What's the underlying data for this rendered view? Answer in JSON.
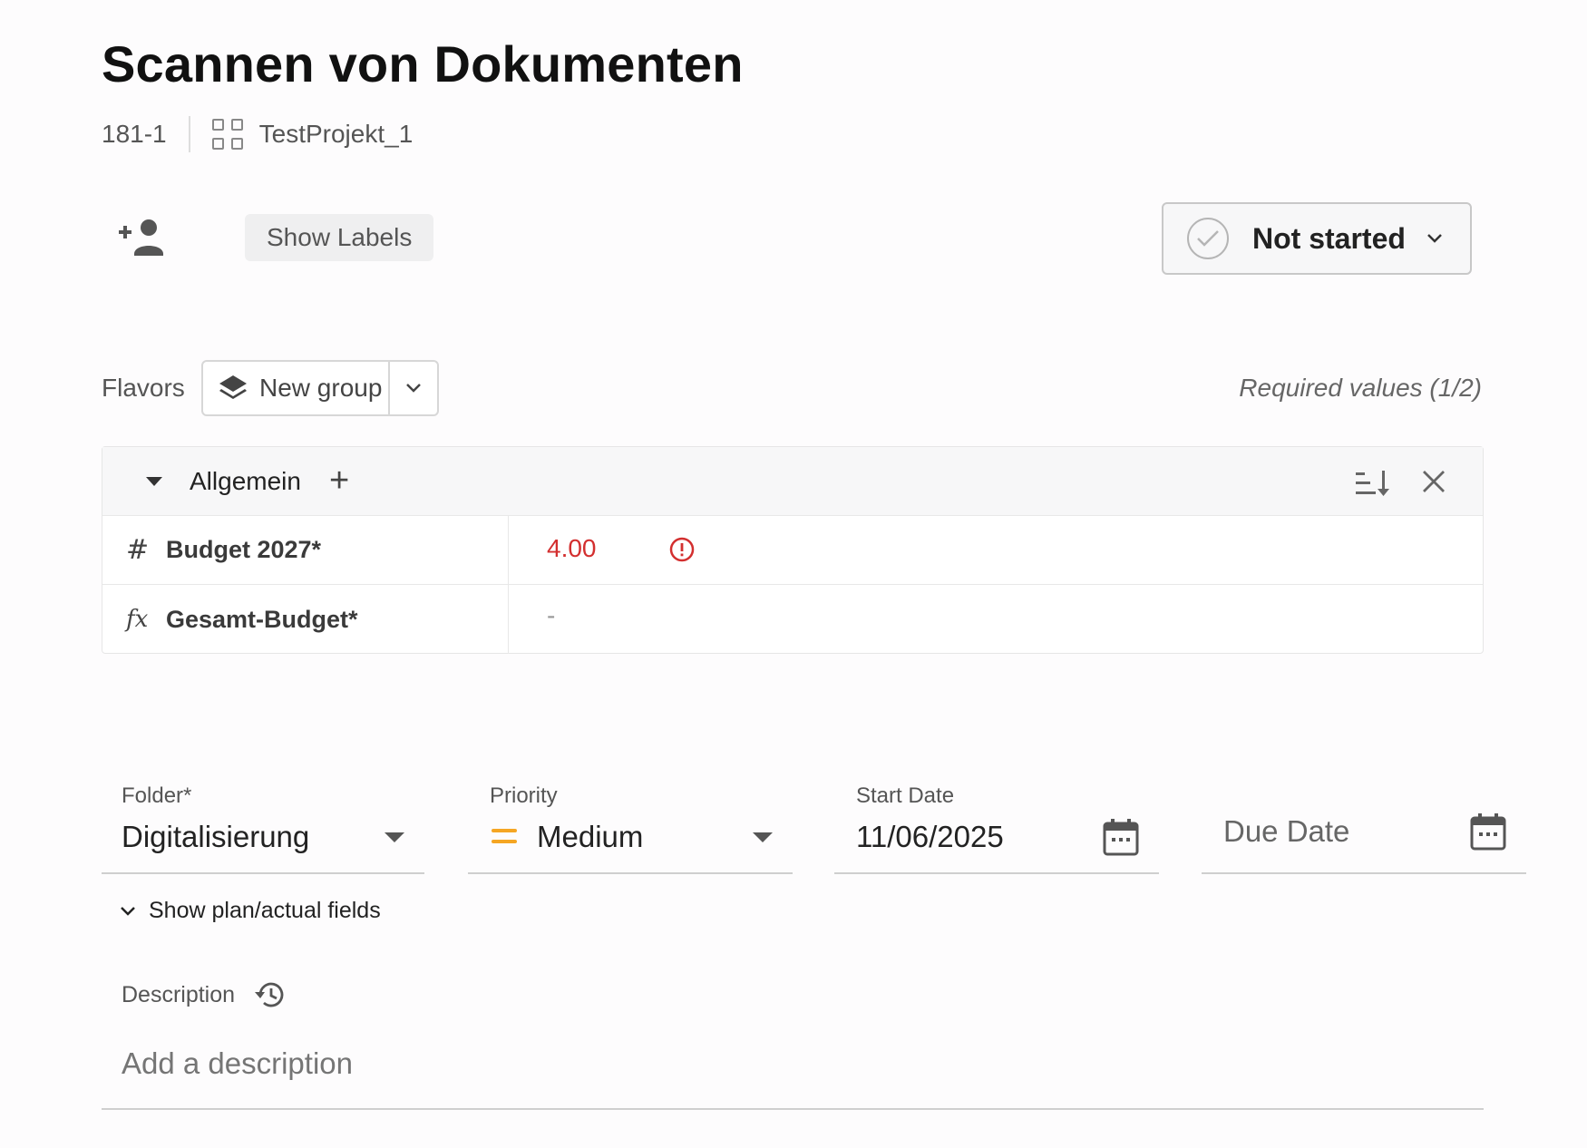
{
  "task": {
    "title": "Scannen von Dokumenten",
    "id": "181-1",
    "project": "TestProjekt_1"
  },
  "toolbar": {
    "show_labels": "Show Labels",
    "status": "Not started"
  },
  "flavors": {
    "label": "Flavors",
    "new_group": "New group",
    "required": "Required values (1/2)"
  },
  "group": {
    "name": "Allgemein",
    "rows": [
      {
        "icon": "#",
        "name": "Budget 2027*",
        "value": "4.00",
        "error": true
      },
      {
        "icon": "fx",
        "name": "Gesamt-Budget*",
        "value": "-"
      }
    ]
  },
  "fields": {
    "folder_label": "Folder*",
    "folder_value": "Digitalisierung",
    "priority_label": "Priority",
    "priority_value": "Medium",
    "start_label": "Start Date",
    "start_value": "11/06/2025",
    "due_placeholder": "Due Date"
  },
  "plan_toggle": "Show plan/actual fields",
  "description": {
    "label": "Description",
    "placeholder": "Add a description"
  },
  "colors": {
    "error": "#d32f2f",
    "priority_medium": "#f5a623"
  }
}
